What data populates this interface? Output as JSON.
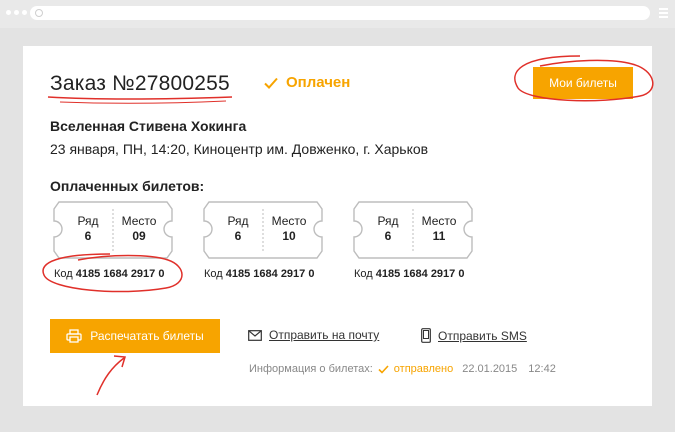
{
  "order": {
    "title": "Заказ №27800255",
    "status": "Оплачен",
    "my_tickets_label": "Мои билеты"
  },
  "event": {
    "title": "Вселенная Стивена Хокинга",
    "details": "23 января, ПН, 14:20, Киноцентр им. Довженко, г. Харьков"
  },
  "tickets_heading": "Оплаченных билетов:",
  "row_label": "Ряд",
  "seat_label": "Место",
  "code_label": "Код",
  "tickets": [
    {
      "row": "6",
      "seat": "09",
      "code": "4185 1684 2917 0"
    },
    {
      "row": "6",
      "seat": "10",
      "code": "4185 1684 2917 0"
    },
    {
      "row": "6",
      "seat": "11",
      "code": "4185 1684 2917 0"
    }
  ],
  "actions": {
    "print_label": "Распечатать билеты",
    "email_label": "Отправить на почту",
    "sms_label": "Отправить SMS"
  },
  "info": {
    "label": "Информация о билетах:",
    "status": "отправлено",
    "date": "22.01.2015",
    "time": "12:42"
  },
  "colors": {
    "accent": "#f7a400",
    "annotation": "#e0302a"
  },
  "icons": {
    "check": "check-icon",
    "printer": "printer-icon",
    "email": "envelope-icon",
    "sms": "phone-icon"
  }
}
